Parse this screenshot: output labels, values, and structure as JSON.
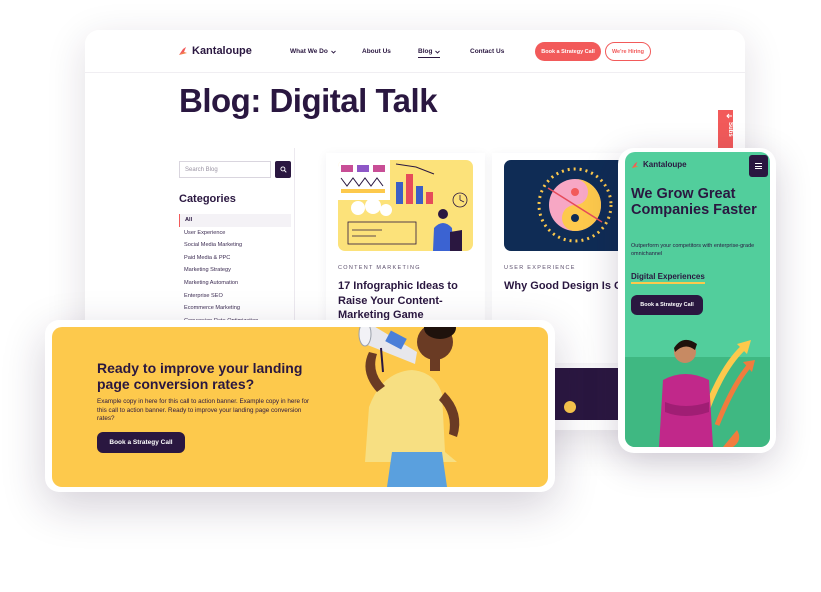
{
  "desktop": {
    "nav": {
      "logo_text": "Kantaloupe",
      "links": [
        "What We Do",
        "About Us",
        "Blog",
        "Contact Us"
      ],
      "cta_primary": "Book a Strategy Call",
      "cta_secondary": "We're Hiring"
    },
    "title": "Blog: Digital Talk",
    "search": {
      "placeholder": "Search Blog"
    },
    "categories": {
      "heading": "Categories",
      "items": [
        "All",
        "User Experience",
        "Social Media Marketing",
        "Paid Media & PPC",
        "Marketing Strategy",
        "Marketing Automation",
        "Enterprise SEO",
        "Ecommerce Marketing",
        "Conversion Rate Optimization"
      ],
      "active": "All"
    },
    "posts": [
      {
        "category": "CONTENT MARKETING",
        "title": "17 Infographic Ideas to Raise Your Content-Marketing Game"
      },
      {
        "category": "USER EXPERIENCE",
        "title": "Why Good Design Is Good Business: How Design Impacts Success"
      }
    ],
    "side_tab": "Subs"
  },
  "banner": {
    "heading": "Ready to improve your landing page conversion rates?",
    "body": "Example copy in here for this call to action banner. Example copy in here for this call to action banner. Ready to improve your landing page conversion rates?",
    "button": "Book a Strategy Call"
  },
  "mobile": {
    "logo_text": "Kantaloupe",
    "heading": "We Grow Great Companies Faster",
    "body": "Outperform your competitors with enterprise-grade omnichannel",
    "link": "Digital Experiences",
    "button": "Book a Strategy Call"
  },
  "colors": {
    "brand_dark": "#2a1740",
    "coral": "#f25a5a",
    "yellow": "#fdc94c",
    "green": "#52ce9c"
  }
}
